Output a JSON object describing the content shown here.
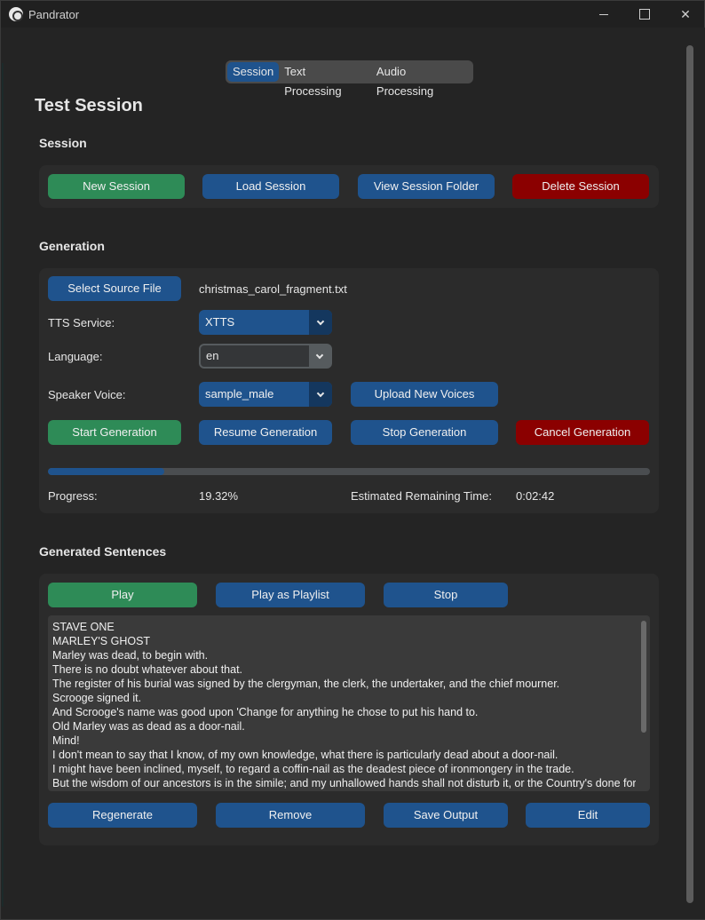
{
  "window": {
    "title": "Pandrator"
  },
  "tabs": [
    {
      "label": "Session",
      "active": true
    },
    {
      "label": "Text Processing",
      "active": false
    },
    {
      "label": "Audio Processing",
      "active": false
    }
  ],
  "page_title": "Test Session",
  "session": {
    "heading": "Session",
    "new_label": "New Session",
    "load_label": "Load Session",
    "view_folder_label": "View Session Folder",
    "delete_label": "Delete Session"
  },
  "generation": {
    "heading": "Generation",
    "select_source_label": "Select Source File",
    "source_file": "christmas_carol_fragment.txt",
    "tts_label": "TTS Service:",
    "tts_value": "XTTS",
    "language_label": "Language:",
    "language_value": "en",
    "speaker_label": "Speaker Voice:",
    "speaker_value": "sample_male",
    "upload_voices_label": "Upload New Voices",
    "start_label": "Start Generation",
    "resume_label": "Resume Generation",
    "stop_label": "Stop Generation",
    "cancel_label": "Cancel Generation",
    "progress_fraction": 0.1932,
    "progress_label": "Progress:",
    "progress_text": "19.32%",
    "remaining_label": "Estimated Remaining Time:",
    "remaining_value": "0:02:42"
  },
  "sentences": {
    "heading": "Generated Sentences",
    "play_label": "Play",
    "playlist_label": "Play as Playlist",
    "stop_label": "Stop",
    "lines": [
      "STAVE ONE",
      "MARLEY'S GHOST",
      "Marley was dead, to begin with.",
      "There is no doubt whatever about that.",
      "The register of his burial was signed by the clergyman, the clerk, the undertaker, and the chief mourner.",
      "Scrooge signed it.",
      "And Scrooge's name was good upon 'Change for anything he chose to put his hand to.",
      "Old Marley was as dead as a door-nail.",
      "Mind!",
      "I don't mean to say that I know, of my own knowledge, what there is particularly dead about a door-nail.",
      "I might have been inclined, myself, to regard a coffin-nail as the deadest piece of ironmongery in the trade.",
      "But the wisdom of our ancestors is in the simile; and my unhallowed hands shall not disturb it, or the Country's done for."
    ],
    "regenerate_label": "Regenerate",
    "remove_label": "Remove",
    "save_label": "Save Output",
    "edit_label": "Edit"
  },
  "colors": {
    "green": "#2e8b57",
    "blue": "#1f538d",
    "red": "#8b0000",
    "background": "#242424",
    "frame": "#2b2b2b"
  }
}
